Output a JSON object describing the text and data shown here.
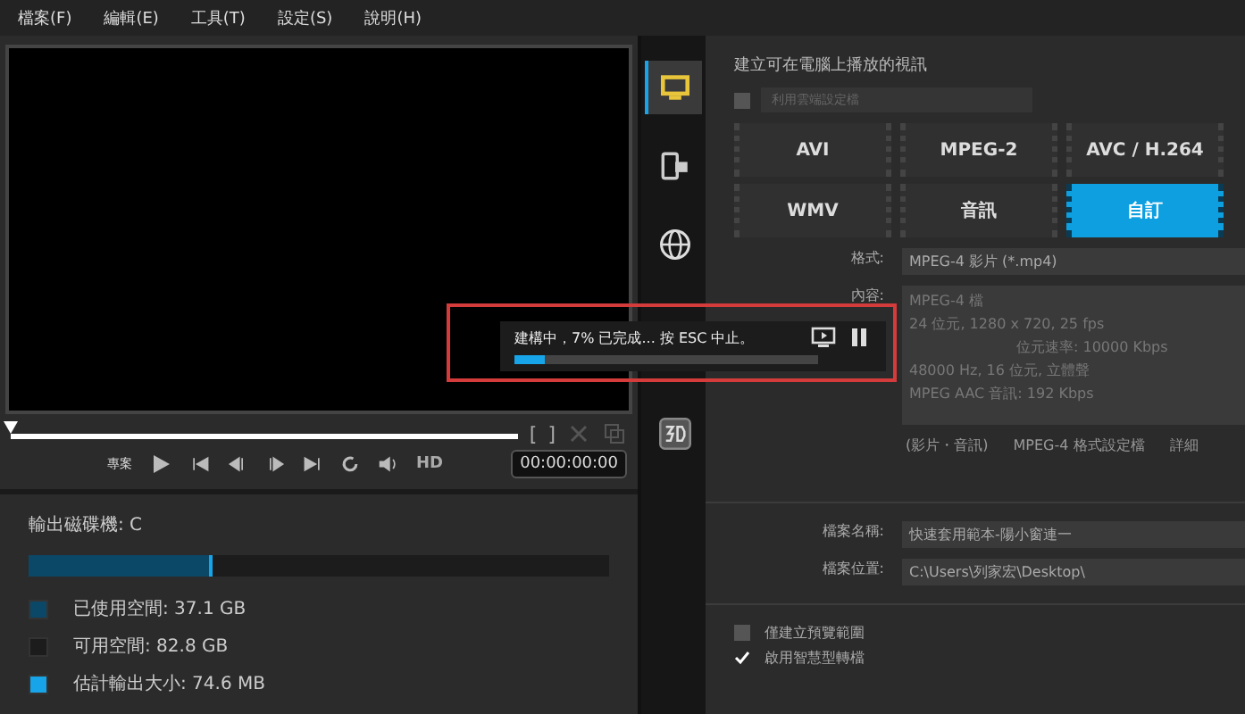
{
  "menu": [
    "檔案(F)",
    "編輯(E)",
    "工具(T)",
    "設定(S)",
    "說明(H)"
  ],
  "player": {
    "position": {
      "level": 0
    },
    "project_label": "專案",
    "hd": "HD",
    "timecode": "00:00:00:00",
    "mark_in": "[",
    "mark_out": "]"
  },
  "disk": {
    "label": "輸出磁碟機: C",
    "level": 0.31,
    "legend": [
      {
        "text": "已使用空間: 37.1 GB",
        "color": "#0b4766"
      },
      {
        "text": "可用空間: 82.8 GB",
        "color": "#1c1c1c"
      },
      {
        "text": "估計輸出大小: 74.6 MB",
        "color": "#18a4e8"
      }
    ]
  },
  "side_tabs": [
    {
      "kind": "computer",
      "selected": true
    },
    {
      "kind": "device",
      "selected": false
    },
    {
      "kind": "web",
      "selected": false
    },
    {
      "kind": "stereo",
      "selected": false
    }
  ],
  "produce": {
    "title": "建立可在電腦上播放的視訊",
    "profile_dropdown": {
      "checked": false,
      "placeholder": "利用雲端設定檔"
    },
    "formats": [
      {
        "label": "AVI",
        "selected": false
      },
      {
        "label": "MPEG-2",
        "selected": false
      },
      {
        "label": "AVC / H.264",
        "selected": false
      },
      {
        "label": "WMV",
        "selected": false
      },
      {
        "label": "音訊",
        "selected": false
      },
      {
        "label": "自訂",
        "selected": true
      }
    ],
    "format_label": "格式:",
    "format_value": "MPEG-4 影片 (*.mp4)",
    "content_label": "內容:",
    "content_lines": [
      "MPEG-4 檔",
      "24 位元, 1280 x 720, 25 fps",
      "位元速率: 10000 Kbps",
      "48000 Hz, 16 位元, 立體聲",
      "MPEG AAC 音訊: 192 Kbps"
    ],
    "profile_type": "(影片・音訊)",
    "profile_name": "MPEG-4 格式設定檔",
    "profile_detail": "詳細",
    "filename_label": "檔案名稱:",
    "filename": "快速套用範本-陽小窗連一",
    "location_label": "檔案位置:",
    "location": "C:\\Users\\列家宏\\Desktop\\",
    "options": [
      {
        "label": "僅建立預覽範圍",
        "checked": false
      },
      {
        "label": "啟用智慧型轉檔",
        "checked": true
      }
    ]
  },
  "progress": {
    "message": "建構中，7% 已完成... 按 ESC 中止。",
    "level": 0.1
  }
}
